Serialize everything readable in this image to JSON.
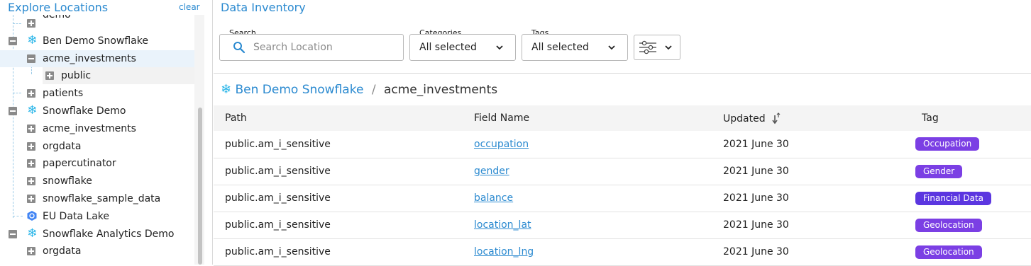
{
  "sidebar": {
    "title": "Explore Locations",
    "clear_label": "clear",
    "items": [
      {
        "label": "demo"
      },
      {
        "label": "Ben Demo Snowflake"
      },
      {
        "label": "acme_investments"
      },
      {
        "label": "public"
      },
      {
        "label": "patients"
      },
      {
        "label": "Snowflake Demo"
      },
      {
        "label": "acme_investments"
      },
      {
        "label": "orgdata"
      },
      {
        "label": "papercutinator"
      },
      {
        "label": "snowflake"
      },
      {
        "label": "snowflake_sample_data"
      },
      {
        "label": "EU Data Lake"
      },
      {
        "label": "Snowflake Analytics Demo"
      },
      {
        "label": "orgdata"
      }
    ]
  },
  "main": {
    "title": "Data Inventory",
    "filters": {
      "search_label": "Search",
      "search_placeholder": "Search Location",
      "categories_label": "Categories",
      "categories_value": "All selected",
      "tags_label": "Tags",
      "tags_value": "All selected"
    },
    "breadcrumb": {
      "root": "Ben Demo Snowflake",
      "separator": "/",
      "current": "acme_investments"
    },
    "table": {
      "columns": [
        "Path",
        "Field Name",
        "Updated",
        "Tag"
      ],
      "rows": [
        {
          "path": "public.am_i_sensitive",
          "field": "occupation",
          "updated": "2021 June 30",
          "tag": "Occupation"
        },
        {
          "path": "public.am_i_sensitive",
          "field": "gender",
          "updated": "2021 June 30",
          "tag": "Gender"
        },
        {
          "path": "public.am_i_sensitive",
          "field": "balance",
          "updated": "2021 June 30",
          "tag": "Financial Data"
        },
        {
          "path": "public.am_i_sensitive",
          "field": "location_lat",
          "updated": "2021 June 30",
          "tag": "Geolocation"
        },
        {
          "path": "public.am_i_sensitive",
          "field": "location_lng",
          "updated": "2021 June 30",
          "tag": "Geolocation"
        }
      ]
    }
  },
  "colors": {
    "accent": "#2b8ad0",
    "tag_purple": "#7b3fe4",
    "tag_indigo": "#5b36e0",
    "snowflake": "#29b5e8"
  },
  "icons": {
    "collapse": "minus-box-icon",
    "expand": "plus-box-icon",
    "snowflake": "snowflake-icon",
    "data_lake": "data-lake-icon",
    "search": "search-icon",
    "chevron": "chevron-down-icon",
    "filter": "sliders-icon",
    "sort": "sort-icon"
  }
}
